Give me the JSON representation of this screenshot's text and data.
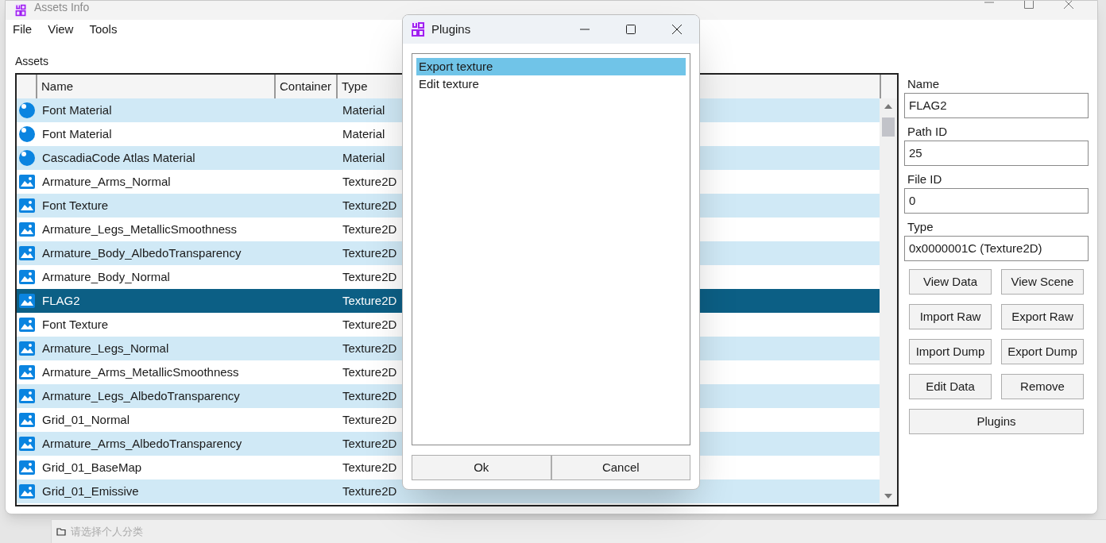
{
  "window": {
    "title": "Assets Info"
  },
  "menu": [
    "File",
    "View",
    "Tools"
  ],
  "assets_label": "Assets",
  "table": {
    "columns": [
      "Name",
      "Container",
      "Type"
    ],
    "rows": [
      {
        "kind": "material",
        "name": "Font Material",
        "type": "Material",
        "selected": false
      },
      {
        "kind": "material",
        "name": "Font Material",
        "type": "Material",
        "selected": false
      },
      {
        "kind": "material",
        "name": "CascadiaCode Atlas Material",
        "type": "Material",
        "selected": false
      },
      {
        "kind": "texture",
        "name": "Armature_Arms_Normal",
        "type": "Texture2D",
        "selected": false
      },
      {
        "kind": "texture",
        "name": "Font Texture",
        "type": "Texture2D",
        "selected": false
      },
      {
        "kind": "texture",
        "name": "Armature_Legs_MetallicSmoothness",
        "type": "Texture2D",
        "selected": false
      },
      {
        "kind": "texture",
        "name": "Armature_Body_AlbedoTransparency",
        "type": "Texture2D",
        "selected": false
      },
      {
        "kind": "texture",
        "name": "Armature_Body_Normal",
        "type": "Texture2D",
        "selected": false
      },
      {
        "kind": "texture",
        "name": "FLAG2",
        "type": "Texture2D",
        "selected": true
      },
      {
        "kind": "texture",
        "name": "Font Texture",
        "type": "Texture2D",
        "selected": false
      },
      {
        "kind": "texture",
        "name": "Armature_Legs_Normal",
        "type": "Texture2D",
        "selected": false
      },
      {
        "kind": "texture",
        "name": "Armature_Arms_MetallicSmoothness",
        "type": "Texture2D",
        "selected": false
      },
      {
        "kind": "texture",
        "name": "Armature_Legs_AlbedoTransparency",
        "type": "Texture2D",
        "selected": false
      },
      {
        "kind": "texture",
        "name": "Grid_01_Normal",
        "type": "Texture2D",
        "selected": false
      },
      {
        "kind": "texture",
        "name": "Armature_Arms_AlbedoTransparency",
        "type": "Texture2D",
        "selected": false
      },
      {
        "kind": "texture",
        "name": "Grid_01_BaseMap",
        "type": "Texture2D",
        "selected": false
      },
      {
        "kind": "texture",
        "name": "Grid_01_Emissive",
        "type": "Texture2D",
        "selected": false
      }
    ]
  },
  "details": {
    "fields": [
      {
        "label": "Name",
        "value": "FLAG2"
      },
      {
        "label": "Path ID",
        "value": "25"
      },
      {
        "label": "File ID",
        "value": "0"
      },
      {
        "label": "Type",
        "value": "0x0000001C (Texture2D)"
      }
    ],
    "buttons": [
      "View Data",
      "View Scene",
      "Import Raw",
      "Export Raw",
      "Import Dump",
      "Export Dump",
      "Edit Data",
      "Remove"
    ],
    "wide_button": "Plugins"
  },
  "dialog": {
    "title": "Plugins",
    "items": [
      {
        "label": "Export texture",
        "selected": true
      },
      {
        "label": "Edit texture",
        "selected": false
      }
    ],
    "buttons": [
      "Ok",
      "Cancel"
    ]
  },
  "background": {
    "category_placeholder": "请选择个人分类"
  }
}
